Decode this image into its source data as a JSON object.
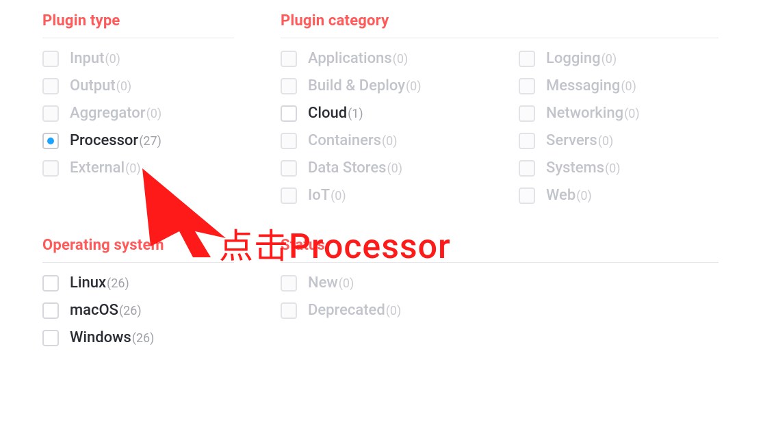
{
  "sections": {
    "plugin_type": {
      "heading": "Plugin type",
      "items": [
        {
          "label": "Input",
          "count": "(0)"
        },
        {
          "label": "Output",
          "count": "(0)"
        },
        {
          "label": "Aggregator",
          "count": "(0)"
        },
        {
          "label": "Processor",
          "count": "(27)"
        },
        {
          "label": "External",
          "count": "(0)"
        }
      ]
    },
    "plugin_category": {
      "heading": "Plugin category",
      "col1": [
        {
          "label": "Applications",
          "count": "(0)"
        },
        {
          "label": "Build & Deploy",
          "count": "(0)"
        },
        {
          "label": "Cloud",
          "count": "(1)"
        },
        {
          "label": "Containers",
          "count": "(0)"
        },
        {
          "label": "Data Stores",
          "count": "(0)"
        },
        {
          "label": "IoT",
          "count": "(0)"
        }
      ],
      "col2": [
        {
          "label": "Logging",
          "count": "(0)"
        },
        {
          "label": "Messaging",
          "count": "(0)"
        },
        {
          "label": "Networking",
          "count": "(0)"
        },
        {
          "label": "Servers",
          "count": "(0)"
        },
        {
          "label": "Systems",
          "count": "(0)"
        },
        {
          "label": "Web",
          "count": "(0)"
        }
      ]
    },
    "operating_system": {
      "heading": "Operating system",
      "items": [
        {
          "label": "Linux",
          "count": "(26)"
        },
        {
          "label": "macOS",
          "count": "(26)"
        },
        {
          "label": "Windows",
          "count": "(26)"
        }
      ]
    },
    "status": {
      "heading": "Status",
      "items": [
        {
          "label": "New",
          "count": "(0)"
        },
        {
          "label": "Deprecated",
          "count": "(0)"
        }
      ]
    }
  },
  "annotation": {
    "text": "点击Processor"
  }
}
